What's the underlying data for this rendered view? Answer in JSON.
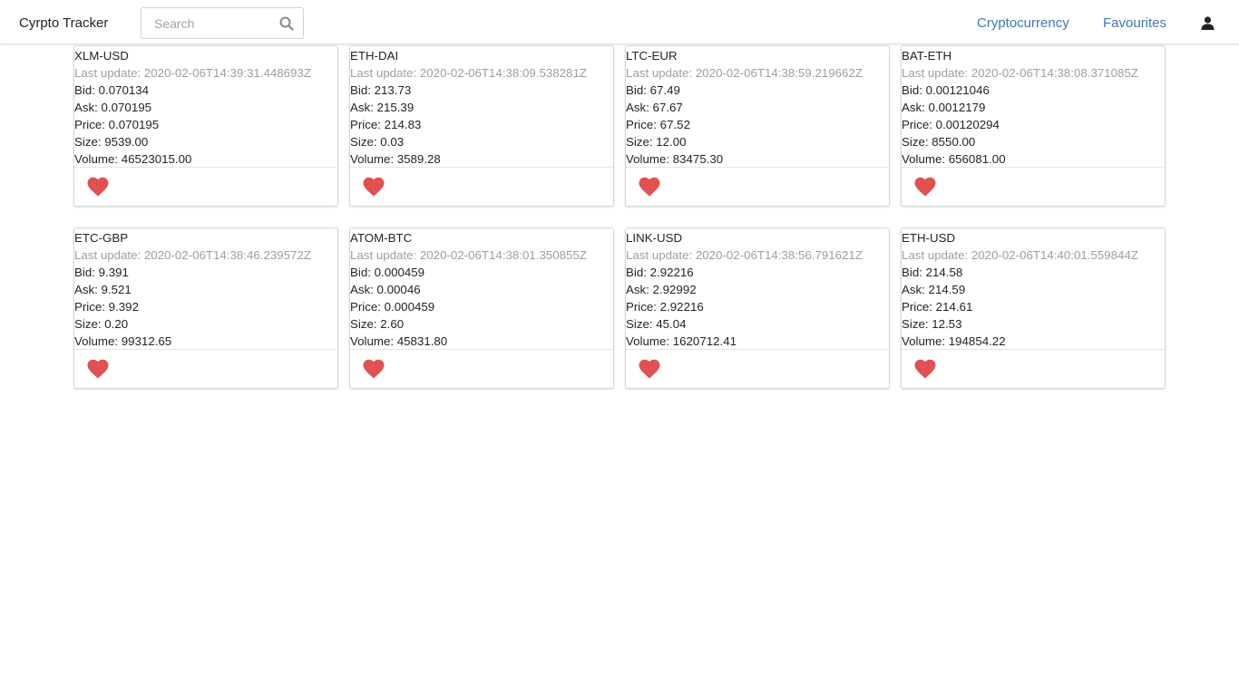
{
  "navbar": {
    "brand": "Cyrpto Tracker",
    "search_placeholder": "Search",
    "links": [
      "Cryptocurrency",
      "Favourites"
    ]
  },
  "colors": {
    "link": "#3f78b8",
    "heart": "#e05252",
    "muted_text": "#9aa0a6"
  },
  "cards": [
    {
      "pair": "XLM-USD",
      "last_update": "Last update: 2020-02-06T14:39:31.448693Z",
      "bid": "Bid: 0.070134",
      "ask": "Ask: 0.070195",
      "price": "Price: 0.070195",
      "size": "Size: 9539.00",
      "volume": "Volume: 46523015.00"
    },
    {
      "pair": "ETH-DAI",
      "last_update": "Last update: 2020-02-06T14:38:09.538281Z",
      "bid": "Bid: 213.73",
      "ask": "Ask: 215.39",
      "price": "Price: 214.83",
      "size": "Size: 0.03",
      "volume": "Volume: 3589.28"
    },
    {
      "pair": "LTC-EUR",
      "last_update": "Last update: 2020-02-06T14:38:59.219662Z",
      "bid": "Bid: 67.49",
      "ask": "Ask: 67.67",
      "price": "Price: 67.52",
      "size": "Size: 12.00",
      "volume": "Volume: 83475.30"
    },
    {
      "pair": "BAT-ETH",
      "last_update": "Last update: 2020-02-06T14:38:08.371085Z",
      "bid": "Bid: 0.00121046",
      "ask": "Ask: 0.0012179",
      "price": "Price: 0.00120294",
      "size": "Size: 8550.00",
      "volume": "Volume: 656081.00"
    },
    {
      "pair": "ETC-GBP",
      "last_update": "Last update: 2020-02-06T14:38:46.239572Z",
      "bid": "Bid: 9.391",
      "ask": "Ask: 9.521",
      "price": "Price: 9.392",
      "size": "Size: 0.20",
      "volume": "Volume: 99312.65"
    },
    {
      "pair": "ATOM-BTC",
      "last_update": "Last update: 2020-02-06T14:38:01.350855Z",
      "bid": "Bid: 0.000459",
      "ask": "Ask: 0.00046",
      "price": "Price: 0.000459",
      "size": "Size: 2.60",
      "volume": "Volume: 45831.80"
    },
    {
      "pair": "LINK-USD",
      "last_update": "Last update: 2020-02-06T14:38:56.791621Z",
      "bid": "Bid: 2.92216",
      "ask": "Ask: 2.92992",
      "price": "Price: 2.92216",
      "size": "Size: 45.04",
      "volume": "Volume: 1620712.41"
    },
    {
      "pair": "ETH-USD",
      "last_update": "Last update: 2020-02-06T14:40:01.559844Z",
      "bid": "Bid: 214.58",
      "ask": "Ask: 214.59",
      "price": "Price: 214.61",
      "size": "Size: 12.53",
      "volume": "Volume: 194854.22"
    }
  ]
}
